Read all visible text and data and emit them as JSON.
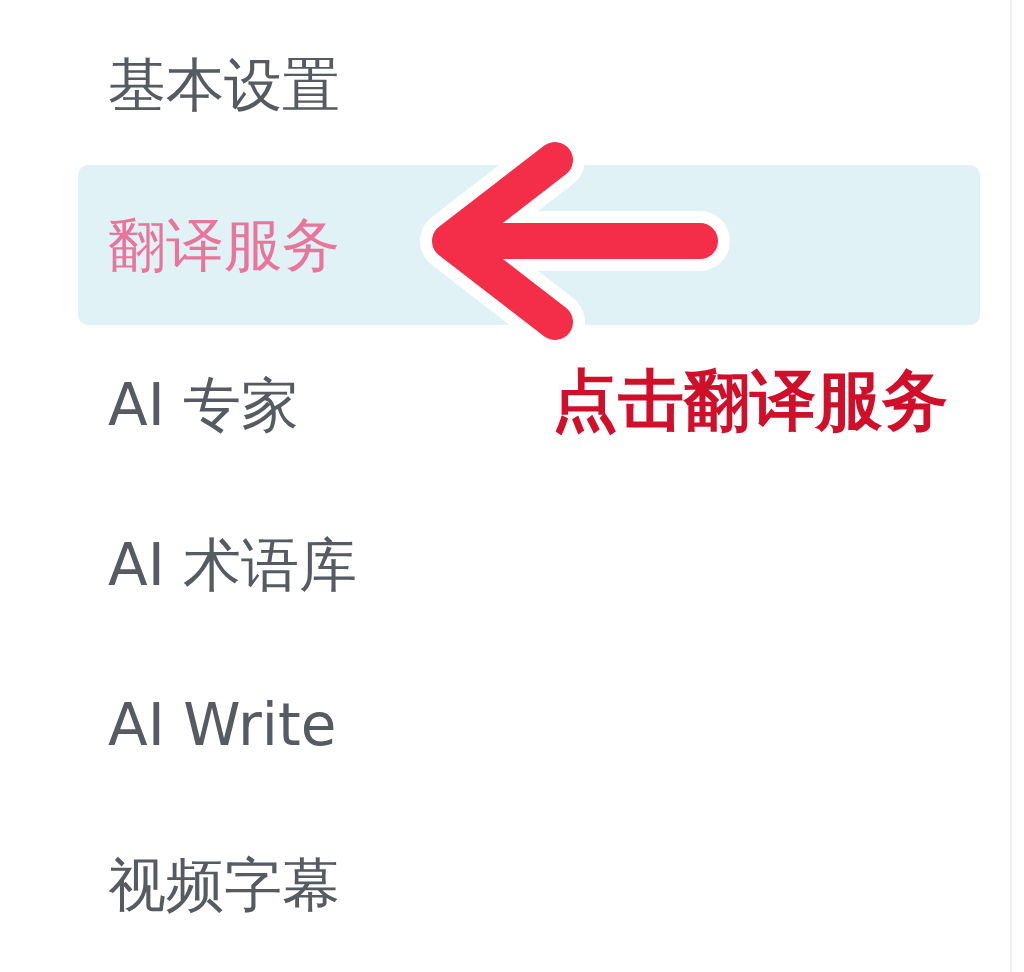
{
  "sidebar": {
    "items": [
      {
        "label": "基本设置",
        "selected": false
      },
      {
        "label": "翻译服务",
        "selected": true
      },
      {
        "label": "AI 专家",
        "selected": false
      },
      {
        "label": "AI 术语库",
        "selected": false
      },
      {
        "label": "AI Write",
        "selected": false
      },
      {
        "label": "视频字幕",
        "selected": false
      }
    ]
  },
  "annotation": {
    "text": "点击翻译服务"
  }
}
